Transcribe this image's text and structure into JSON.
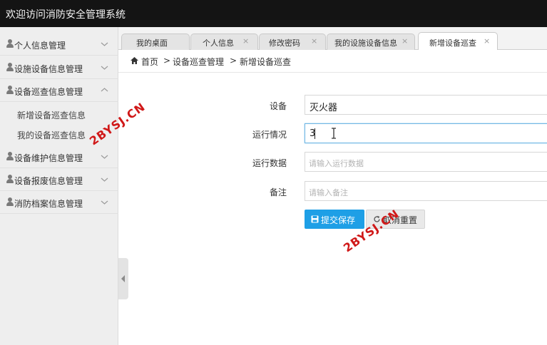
{
  "app": {
    "title": "欢迎访问消防安全管理系统"
  },
  "sidebar": {
    "items": [
      {
        "label": "个人信息管理"
      },
      {
        "label": "设施设备信息管理"
      },
      {
        "label": "设备巡查信息管理",
        "expanded": true
      },
      {
        "label": "设备维护信息管理"
      },
      {
        "label": "设备报废信息管理"
      },
      {
        "label": "消防档案信息管理"
      }
    ],
    "subitems": [
      {
        "label": "新增设备巡查信息"
      },
      {
        "label": "我的设备巡查信息"
      }
    ]
  },
  "tabs": [
    {
      "label": "我的桌面"
    },
    {
      "label": "个人信息",
      "close": "×"
    },
    {
      "label": "修改密码",
      "close": "×"
    },
    {
      "label": "我的设施设备信息",
      "close": "×"
    },
    {
      "label": "新增设备巡查",
      "close": "×",
      "active": true
    }
  ],
  "breadcrumb": {
    "home": "首页",
    "sep": ">",
    "level1": "设备巡查管理",
    "level2": "新增设备巡查"
  },
  "form": {
    "device": {
      "label": "设备",
      "value": "灭火器"
    },
    "status": {
      "label": "运行情况",
      "value": "3"
    },
    "data": {
      "label": "运行数据",
      "placeholder": "请输入运行数据"
    },
    "note": {
      "label": "备注",
      "placeholder": "请输入备注"
    }
  },
  "buttons": {
    "submit": "提交保存",
    "reset": "取消重置"
  },
  "watermark": "2BYSJ.CN",
  "colors": {
    "accent": "#1e9fe6",
    "topbar": "#141414",
    "watermark": "#d01818"
  }
}
